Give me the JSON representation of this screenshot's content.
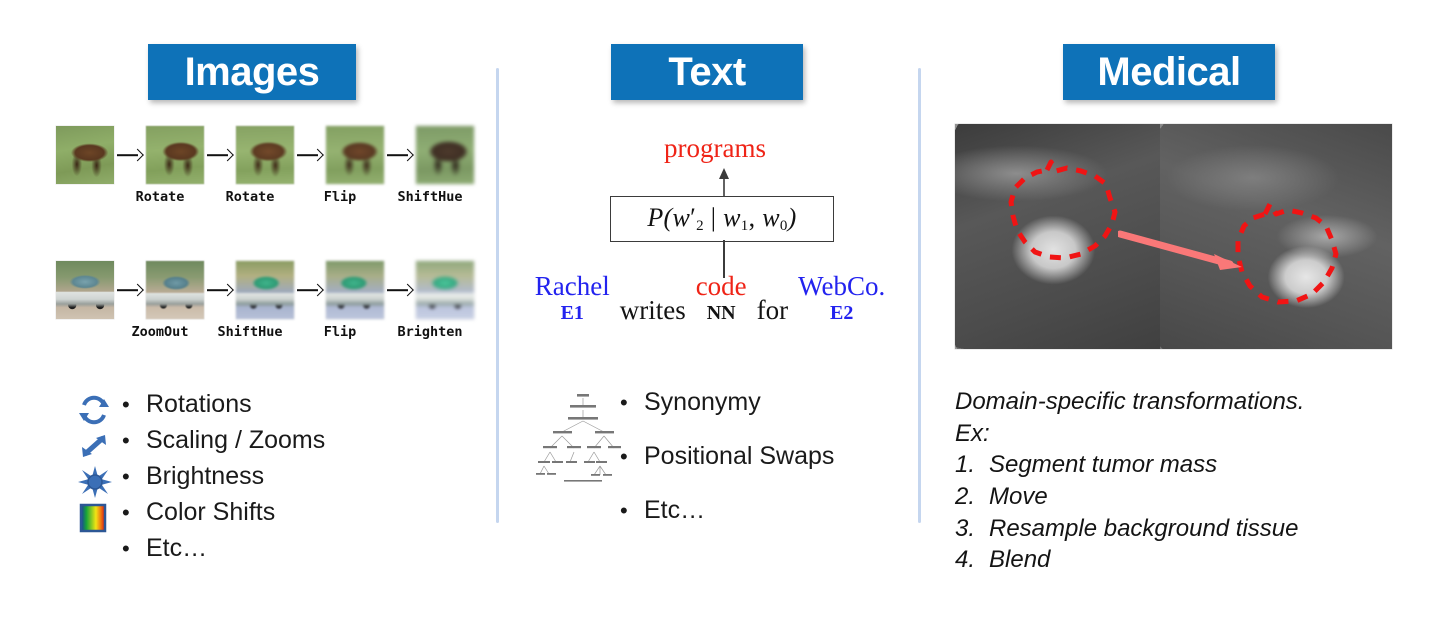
{
  "slide": {
    "background": "#ffffff",
    "accent_blue": "#0e72b8",
    "divider_color": "#c5d6ef",
    "icon_blue": "#3b6fb6",
    "red": "#ef2417",
    "entity_blue": "#2323ef",
    "arrow_pink": "#fa7878"
  },
  "columns": {
    "images": {
      "title": "Images",
      "rows": [
        {
          "name": "horse-augmentation-row",
          "thumbnails": [
            "horse-original",
            "horse-rotate-1",
            "horse-rotate-2",
            "horse-flip",
            "horse-shifthue"
          ],
          "operations": [
            "Rotate",
            "Rotate",
            "Flip",
            "ShiftHue"
          ]
        },
        {
          "name": "car-augmentation-row",
          "thumbnails": [
            "car-original",
            "car-zoomout",
            "car-shifthue",
            "car-flip",
            "car-brighten"
          ],
          "operations": [
            "ZoomOut",
            "ShiftHue",
            "Flip",
            "Brighten"
          ]
        }
      ],
      "icons": [
        "rotate-icon",
        "scale-arrows-icon",
        "brightness-sun-icon",
        "color-spectrum-icon"
      ],
      "bullets": [
        "Rotations",
        "Scaling / Zooms",
        "Brightness",
        "Color Shifts",
        "Etc…"
      ],
      "bullet_marker": "•"
    },
    "text": {
      "title": "Text",
      "prediction_label": "programs",
      "formula": {
        "prefix": "P(w",
        "prime_sub": "2",
        "separator": "|",
        "cond1_sub": "1",
        "cond2_sub": "0",
        "full": "P(w'2 | w1, w0)"
      },
      "sentence": [
        {
          "word": "Rachel",
          "tag": "E1",
          "kind": "entity"
        },
        {
          "word": "writes",
          "tag": "",
          "kind": "plain"
        },
        {
          "word": "code",
          "tag": "NN",
          "kind": "target"
        },
        {
          "word": "for",
          "tag": "",
          "kind": "plain"
        },
        {
          "word": "WebCo.",
          "tag": "E2",
          "kind": "entity"
        }
      ],
      "icon": "parse-tree-icon",
      "bullets": [
        "Synonymy",
        "Positional Swaps",
        "Etc…"
      ],
      "bullet_marker": "•"
    },
    "medical": {
      "title": "Medical",
      "figure": {
        "name": "mammogram-pair",
        "left_panel": "mammogram-source-with-tumor-outline",
        "right_panel": "mammogram-target-with-moved-tumor-outline",
        "arrow": "move-tumor-arrow",
        "outline_style": "red-dashed"
      },
      "caption_line1": "Domain-specific transformations.",
      "caption_line2": "Ex:",
      "steps": [
        {
          "num": "1.",
          "text": "Segment tumor mass"
        },
        {
          "num": "2.",
          "text": "Move"
        },
        {
          "num": "3.",
          "text": "Resample background tissue"
        },
        {
          "num": "4.",
          "text": "Blend"
        }
      ]
    }
  }
}
